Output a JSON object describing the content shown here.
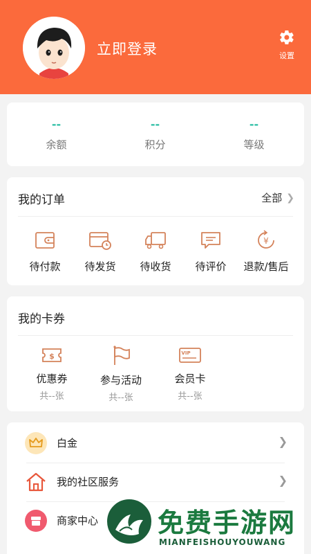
{
  "header": {
    "login_label": "立即登录",
    "settings_label": "设置",
    "bg_color": "#fb6a3c"
  },
  "stats": [
    {
      "value": "--",
      "label": "余额"
    },
    {
      "value": "--",
      "label": "积分"
    },
    {
      "value": "--",
      "label": "等级"
    }
  ],
  "orders": {
    "title": "我的订单",
    "all_label": "全部",
    "items": [
      {
        "label": "待付款",
        "icon": "wallet-icon"
      },
      {
        "label": "待发货",
        "icon": "card-clock-icon"
      },
      {
        "label": "待收货",
        "icon": "truck-icon"
      },
      {
        "label": "待评价",
        "icon": "comment-icon"
      },
      {
        "label": "退款/售后",
        "icon": "refund-icon"
      }
    ]
  },
  "coupons": {
    "title": "我的卡券",
    "items": [
      {
        "label": "优惠券",
        "count": "共--张",
        "icon": "coupon-icon"
      },
      {
        "label": "参与活动",
        "count": "共--张",
        "icon": "flag-icon"
      },
      {
        "label": "会员卡",
        "count": "共--张",
        "icon": "vip-card-icon"
      }
    ]
  },
  "menu": [
    {
      "label": "白金",
      "icon": "crown-icon"
    },
    {
      "label": "我的社区服务",
      "icon": "house-icon"
    },
    {
      "label": "商家中心",
      "icon": "store-icon"
    }
  ],
  "watermark": {
    "title": "免费手游网",
    "subtitle": "MIANFEISHOUYOUWANG"
  },
  "colors": {
    "accent": "#fb6a3c",
    "stat_value": "#2ebfa5",
    "icon_stroke": "#d4825a"
  }
}
